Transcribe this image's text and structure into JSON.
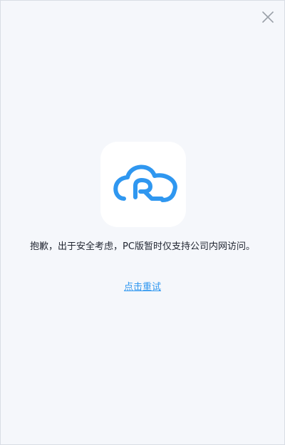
{
  "dialog": {
    "close_icon": "close-icon",
    "logo_icon": "cloud-r-logo-icon",
    "accent_color": "#2f97f0",
    "message": "抱歉，出于安全考虑，PC版暂时仅支持公司内网访问。",
    "retry_label": "点击重试"
  }
}
